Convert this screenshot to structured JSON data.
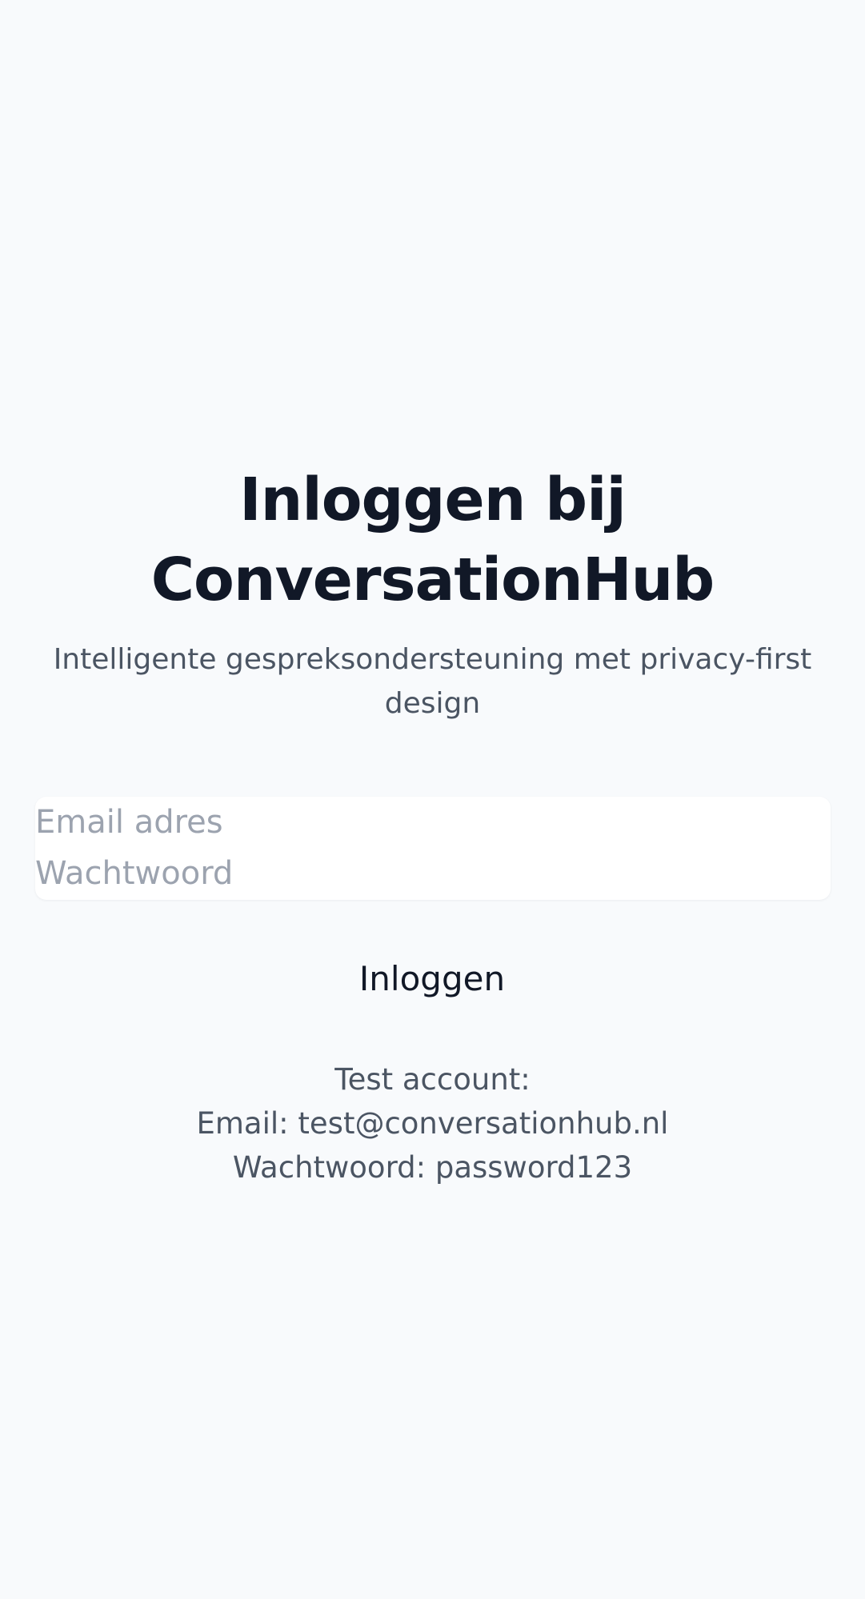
{
  "header": {
    "title_line1": "Inloggen bij",
    "title_line2": "ConversationHub",
    "subtitle": "Intelligente gespreksondersteuning met privacy-first design"
  },
  "form": {
    "email_placeholder": "Email adres",
    "email_value": "",
    "password_placeholder": "Wachtwoord",
    "password_value": ""
  },
  "actions": {
    "login_label": "Inloggen"
  },
  "test_account": {
    "heading": "Test account:",
    "email_line": "Email: test@conversationhub.nl",
    "password_line": "Wachtwoord: password123"
  },
  "colors": {
    "background": "#f8fafc",
    "title": "#111827",
    "muted_text": "#4b5563",
    "placeholder": "#9ca3af",
    "card": "#ffffff"
  }
}
